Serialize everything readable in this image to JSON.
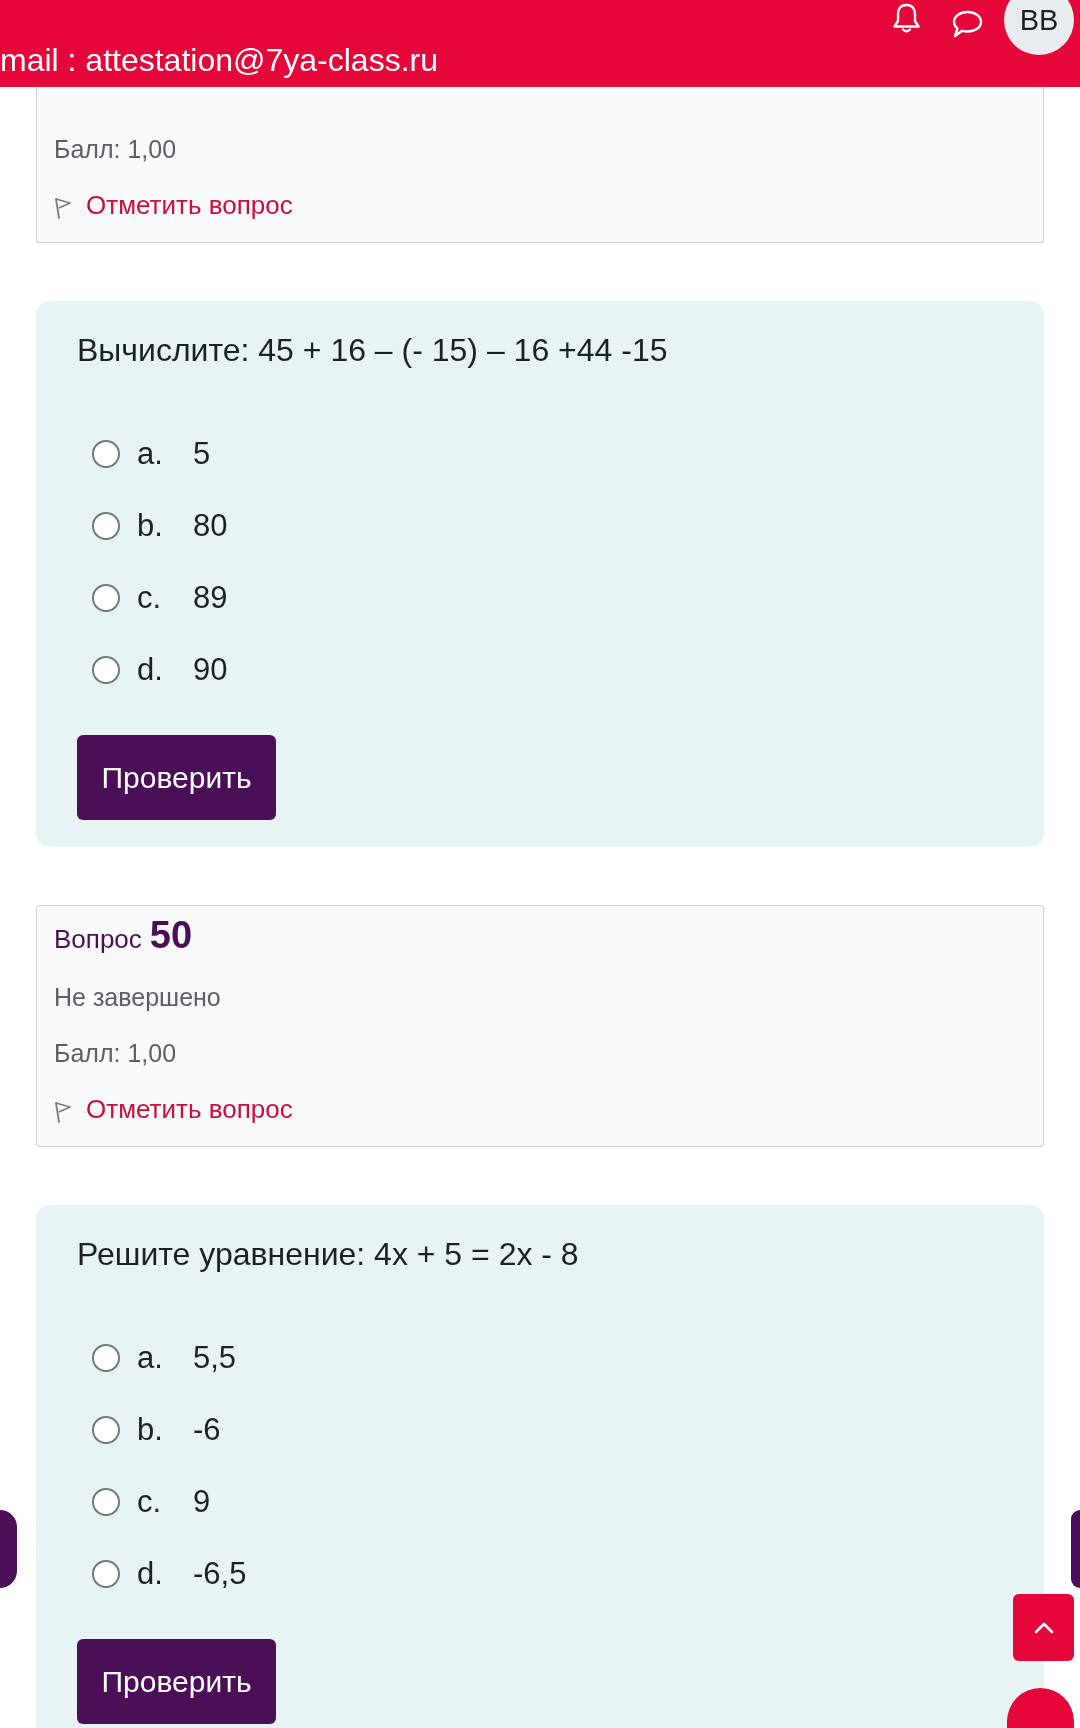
{
  "header": {
    "email_line": "mail : attestation@7ya-class.ru",
    "avatar_initials": "BB"
  },
  "questions": [
    {
      "kind": "info",
      "score": "Балл: 1,00",
      "flag_label": "Отметить вопрос"
    },
    {
      "kind": "formulation",
      "text": "Вычислите: 45 + 16 – (- 15) – 16 +44 -15",
      "options": [
        {
          "letter": "a.",
          "value": "5",
          "selected": false
        },
        {
          "letter": "b.",
          "value": "80",
          "selected": false
        },
        {
          "letter": "c.",
          "value": "89",
          "selected": false
        },
        {
          "letter": "d.",
          "value": "90",
          "selected": false
        }
      ],
      "check_button": "Проверить"
    },
    {
      "kind": "info",
      "label": "Вопрос",
      "number": "50",
      "status": "Не завершено",
      "score": "Балл: 1,00",
      "flag_label": "Отметить вопрос"
    },
    {
      "kind": "formulation",
      "text": "Решите уравнение: 4x + 5 = 2x - 8",
      "options": [
        {
          "letter": "a.",
          "value": "5,5",
          "selected": false
        },
        {
          "letter": "b.",
          "value": "-6",
          "selected": false
        },
        {
          "letter": "c.",
          "value": "9",
          "selected": false
        },
        {
          "letter": "d.",
          "value": "-6,5",
          "selected": false
        }
      ],
      "check_button": "Проверить"
    }
  ]
}
